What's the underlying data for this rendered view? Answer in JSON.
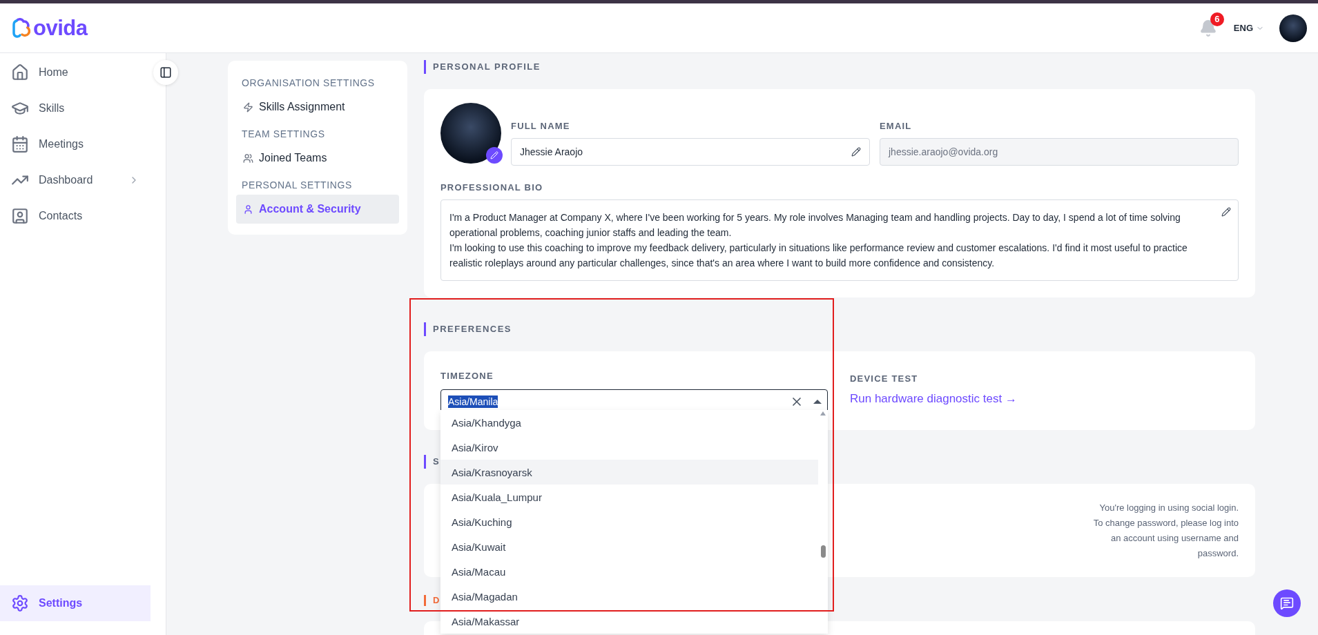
{
  "header": {
    "logo": "ovida",
    "notifications": "6",
    "language": "ENG"
  },
  "sidebar": {
    "items": [
      {
        "label": "Home",
        "expandable": false,
        "selected": false
      },
      {
        "label": "Skills",
        "expandable": false,
        "selected": false
      },
      {
        "label": "Meetings",
        "expandable": false,
        "selected": false
      },
      {
        "label": "Dashboard",
        "expandable": true,
        "selected": false
      },
      {
        "label": "Contacts",
        "expandable": false,
        "selected": false
      }
    ],
    "footer_item": {
      "label": "Settings",
      "selected": true
    }
  },
  "settings_nav": {
    "sections": [
      {
        "title": "ORGANISATION SETTINGS",
        "items": [
          {
            "label": "Skills Assignment",
            "selected": false
          }
        ]
      },
      {
        "title": "TEAM SETTINGS",
        "items": [
          {
            "label": "Joined Teams",
            "selected": false
          }
        ]
      },
      {
        "title": "PERSONAL SETTINGS",
        "items": [
          {
            "label": "Account & Security",
            "selected": true
          }
        ]
      }
    ]
  },
  "personal_profile": {
    "title": "PERSONAL PROFILE",
    "full_name_label": "FULL NAME",
    "full_name": "Jhessie Araojo",
    "email_label": "EMAIL",
    "email": "jhessie.araojo@ovida.org",
    "bio_label": "PROFESSIONAL BIO",
    "bio": [
      "I'm a Product Manager at Company X, where I've been working for 5 years. My role involves Managing team and handling projects. Day to day, I spend a lot of time solving operational problems, coaching junior staffs and leading the team.",
      "I'm looking to use this coaching to improve my feedback delivery, particularly in situations like performance review and customer escalations. I'd find it most useful to practice realistic roleplays around any particular challenges, since that's an area where I want to build more confidence and consistency."
    ]
  },
  "preferences": {
    "title": "PREFERENCES",
    "timezone_label": "TIMEZONE",
    "timezone": "Asia/Manila",
    "timezone_open": true,
    "options": [
      {
        "label": "Asia/Khandyga",
        "highlighted": false
      },
      {
        "label": "Asia/Kirov",
        "highlighted": false
      },
      {
        "label": "Asia/Krasnoyarsk",
        "highlighted": true
      },
      {
        "label": "Asia/Kuala_Lumpur",
        "highlighted": false
      },
      {
        "label": "Asia/Kuching",
        "highlighted": false
      },
      {
        "label": "Asia/Kuwait",
        "highlighted": false
      },
      {
        "label": "Asia/Macau",
        "highlighted": false
      },
      {
        "label": "Asia/Magadan",
        "highlighted": false
      },
      {
        "label": "Asia/Makassar",
        "highlighted": false
      }
    ],
    "device_test_label": "DEVICE TEST",
    "device_test_link": "Run hardware diagnostic test →"
  },
  "security": {
    "title": "S",
    "note": "You're logging in using social login. To change password, please log into an account using username and password."
  },
  "danger": {
    "title": "D"
  }
}
